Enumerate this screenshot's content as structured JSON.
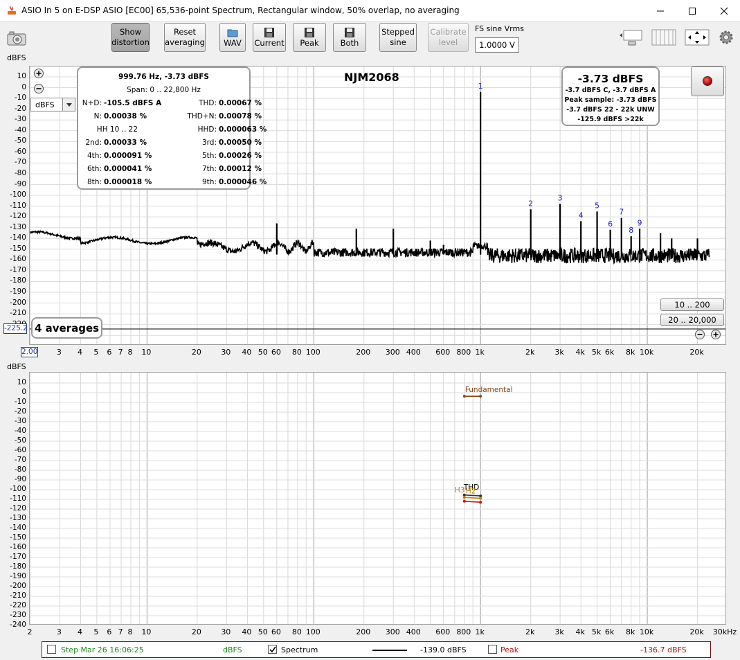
{
  "window": {
    "title": "ASIO In 5 on E-DSP ASIO [EC00] 65,536-point Spectrum, Rectangular window, 50% overlap, no averaging",
    "controls": [
      "minimize-icon",
      "maximize-icon",
      "close-icon"
    ]
  },
  "toolbar": {
    "show_distortion": [
      "Show",
      "distortion"
    ],
    "reset_averaging": [
      "Reset",
      "averaging"
    ],
    "wav": "WAV",
    "current": "Current",
    "peak": "Peak",
    "both": "Both",
    "stepped_sine": [
      "Stepped",
      "sine"
    ],
    "calibrate_level": [
      "Calibrate",
      "level"
    ],
    "fs_label": "FS sine Vrms",
    "fs_value": "1.0000 V"
  },
  "spectrum": {
    "y_unit": "dBFS",
    "y_ticks": [
      "10",
      "0",
      "-10",
      "-20",
      "-30",
      "-40",
      "-50",
      "-60",
      "-70",
      "-80",
      "-90",
      "-100",
      "-110",
      "-120",
      "-130",
      "-140",
      "-150",
      "-160",
      "-170",
      "-180",
      "-190",
      "-200",
      "-210",
      "-220"
    ],
    "x_ticks": [
      "2",
      "3",
      "4",
      "5",
      "6",
      "7",
      "8",
      "10",
      "20",
      "30",
      "40",
      "50",
      "60",
      "80",
      "100",
      "200",
      "300",
      "400",
      "600",
      "800",
      "1k",
      "2k",
      "3k",
      "4k",
      "5k",
      "6k",
      "8k",
      "10k",
      "20k"
    ],
    "unit_select": "dBFS",
    "title": "NJM2068",
    "y_cursor": "-225.2",
    "x_cursor": "2.00",
    "averages": "4 averages",
    "range_buttons": [
      "10 .. 200",
      "20 .. 20,000"
    ],
    "harmonic_labels": [
      "1",
      "2",
      "3",
      "4",
      "5",
      "6",
      "7",
      "8",
      "9"
    ]
  },
  "distortion": {
    "header": "999.76 Hz, -3.73 dBFS",
    "span": "Span: 0 .. 22,800 Hz",
    "rows": [
      {
        "l_label": "N+D:",
        "l_value": "-105.5 dBFS A",
        "r_label": "THD:",
        "r_value": "0.00067 %"
      },
      {
        "l_label": "N:",
        "l_value": "0.00038 %",
        "r_label": "THD+N:",
        "r_value": "0.00078 %"
      },
      {
        "l_label": "HH 10 .. 22",
        "l_value": "",
        "r_label": "HHD:",
        "r_value": "0.000063 %"
      },
      {
        "l_label": "2nd:",
        "l_value": "0.00033 %",
        "r_label": "3rd:",
        "r_value": "0.00050 %"
      },
      {
        "l_label": "4th:",
        "l_value": "0.000091 %",
        "r_label": "5th:",
        "r_value": "0.00026 %"
      },
      {
        "l_label": "6th:",
        "l_value": "0.000041 %",
        "r_label": "7th:",
        "r_value": "0.00012 %"
      },
      {
        "l_label": "8th:",
        "l_value": "0.000018 %",
        "r_label": "9th:",
        "r_value": "0.000046 %"
      }
    ]
  },
  "level": {
    "main": "-3.73 dBFS",
    "lines": [
      "-3.7 dBFS C, -3.7 dBFS A",
      "Peak sample: -3.73 dBFS",
      "-3.7 dBFS 22 - 22k UNW",
      "-125.9 dBFS >22k"
    ]
  },
  "lower": {
    "y_unit": "dBFS",
    "y_ticks": [
      "10",
      "0",
      "-10",
      "-20",
      "-30",
      "-40",
      "-50",
      "-60",
      "-70",
      "-80",
      "-90",
      "-100",
      "-110",
      "-120",
      "-130",
      "-140",
      "-150",
      "-160",
      "-170",
      "-180",
      "-190",
      "-200",
      "-210",
      "-220",
      "-230",
      "-240"
    ],
    "x_ticks": [
      "2",
      "3",
      "4",
      "5",
      "6",
      "7",
      "8",
      "10",
      "20",
      "30",
      "40",
      "50",
      "60",
      "80",
      "100",
      "200",
      "300",
      "400",
      "600",
      "800",
      "1k",
      "2k",
      "3k",
      "4k",
      "5k",
      "6k",
      "8k",
      "10k",
      "20k",
      "30kHz"
    ],
    "fundamental_label": "Fundamental",
    "thd_label": "THD",
    "h3_label": "H3",
    "h2_label": "H2"
  },
  "status": {
    "step_text": "Step Mar 26 16:06:25",
    "unit": "dBFS",
    "spectrum_label": "Spectrum",
    "spectrum_value": "-139.0 dBFS",
    "peak_label": "Peak",
    "peak_value": "-136.7 dBFS"
  },
  "colors": {
    "trace": "#000000",
    "harmonic_label": "#1c1cc8",
    "fundamental": "#8b4513",
    "thd": "#333333",
    "h2": "#b8860b",
    "h3": "#cc1010",
    "status_green": "#1a8a1a",
    "status_red": "#b01010"
  }
}
